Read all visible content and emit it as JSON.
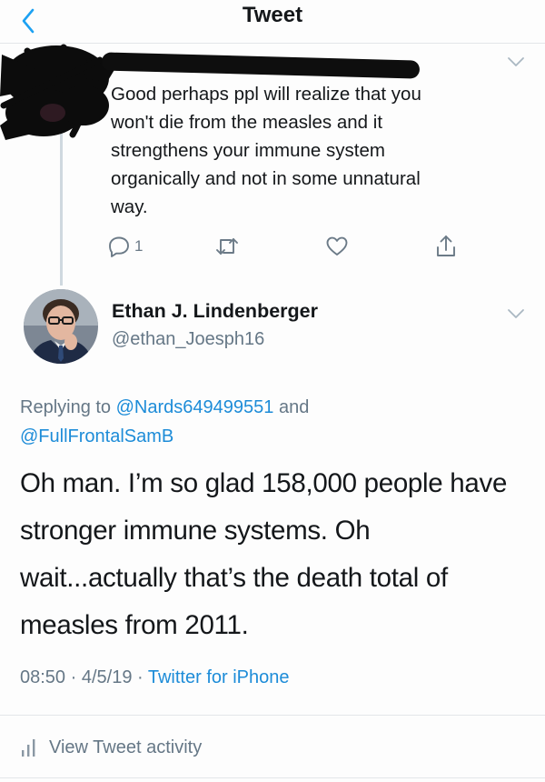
{
  "nav": {
    "title": "Tweet",
    "back_icon": "chevron-left-icon",
    "accent": "#1da1f2"
  },
  "parent_tweet": {
    "text": "Good perhaps ppl will realize that you\nwon't die from the measles and it\nstrengthens your immune system\norganically and not in some unnatural\nway.",
    "reply_count": "1",
    "author_redacted": true,
    "actions": {
      "reply_icon": "reply-icon",
      "retweet_icon": "retweet-icon",
      "like_icon": "heart-icon",
      "share_icon": "share-icon"
    }
  },
  "tweet": {
    "display_name": "Ethan J. Lindenberger",
    "handle": "@ethan_Joesph16",
    "replying_prefix": "Replying to ",
    "replying_to": [
      "@Nards649499551",
      "@FullFrontalSamB"
    ],
    "replying_joiner": " and",
    "text": "Oh man. I’m so glad 158,000 people have stronger immune systems. Oh wait...actually that’s the death total of measles from 2011.",
    "time": "08:50",
    "date": "4/5/19",
    "separator": " · ",
    "source": "Twitter for iPhone",
    "activity_label": "View Tweet activity",
    "activity_icon": "bar-chart-icon",
    "link_color": "#1d8cd8",
    "muted_color": "#657786"
  }
}
